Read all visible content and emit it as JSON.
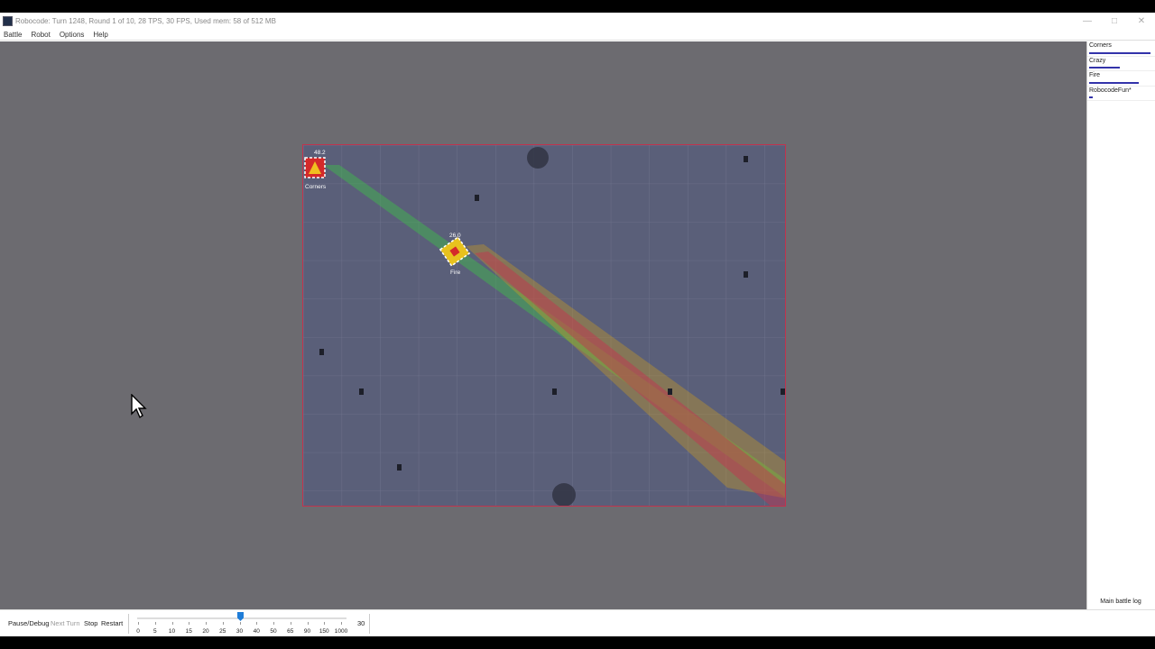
{
  "window": {
    "title": "Robocode: Turn 1248, Round 1 of 10, 28 TPS, 30 FPS, Used mem: 58 of 512 MB",
    "controls": [
      "minimize-icon",
      "restore-icon",
      "close-icon"
    ]
  },
  "menu": {
    "items": [
      "Battle",
      "Robot",
      "Options",
      "Help"
    ]
  },
  "battlefield": {
    "colors": {
      "floor": "#5a5f79",
      "border": "#c0334e",
      "green_beam": "#3fbf4a",
      "orange_beam": "#d8a31a",
      "red_beam": "#c83050"
    },
    "robots": [
      {
        "name": "Corners",
        "energy": "48.2"
      },
      {
        "name": "Fire",
        "energy": "26.0"
      }
    ]
  },
  "side_panel": {
    "robots": [
      {
        "name": "Corners",
        "health": 0.97
      },
      {
        "name": "Crazy",
        "health": 0.48
      },
      {
        "name": "Fire",
        "health": 0.78
      },
      {
        "name": "RobocodeFun*",
        "health": 0.06
      }
    ],
    "log_button": "Main battle log"
  },
  "bottom_bar": {
    "buttons": {
      "pause": "Pause/Debug",
      "next_turn": "Next Turn",
      "stop": "Stop",
      "restart": "Restart"
    },
    "tps_slider": {
      "ticks": [
        "0",
        "5",
        "10",
        "15",
        "20",
        "25",
        "30",
        "40",
        "50",
        "65",
        "90",
        "150",
        "1000"
      ],
      "value": "30"
    }
  }
}
